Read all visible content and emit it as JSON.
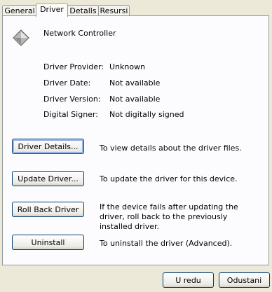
{
  "tabs": [
    {
      "label": "General"
    },
    {
      "label": "Driver"
    },
    {
      "label": "Detalls"
    },
    {
      "label": "Resursi"
    }
  ],
  "device": {
    "name": "Network Controller",
    "icon": "network-device-icon"
  },
  "properties": [
    {
      "label": "Driver Provider:",
      "value": "Unknown"
    },
    {
      "label": "Driver Date:",
      "value": "Not available"
    },
    {
      "label": "Driver Version:",
      "value": "Not available"
    },
    {
      "label": "Digital Signer:",
      "value": "Not digitally signed"
    }
  ],
  "actions": [
    {
      "button": "Driver Details...",
      "description": "To view details about the driver files."
    },
    {
      "button": "Update Driver...",
      "description": "To update the driver for this device."
    },
    {
      "button": "Roll Back Driver",
      "description": "If the device fails after updating the driver, roll back to the previously installed driver."
    },
    {
      "button": "Uninstall",
      "description": "To uninstall the driver (Advanced)."
    }
  ],
  "footer": {
    "ok_label": "U redu",
    "cancel_label": "Odustani"
  }
}
